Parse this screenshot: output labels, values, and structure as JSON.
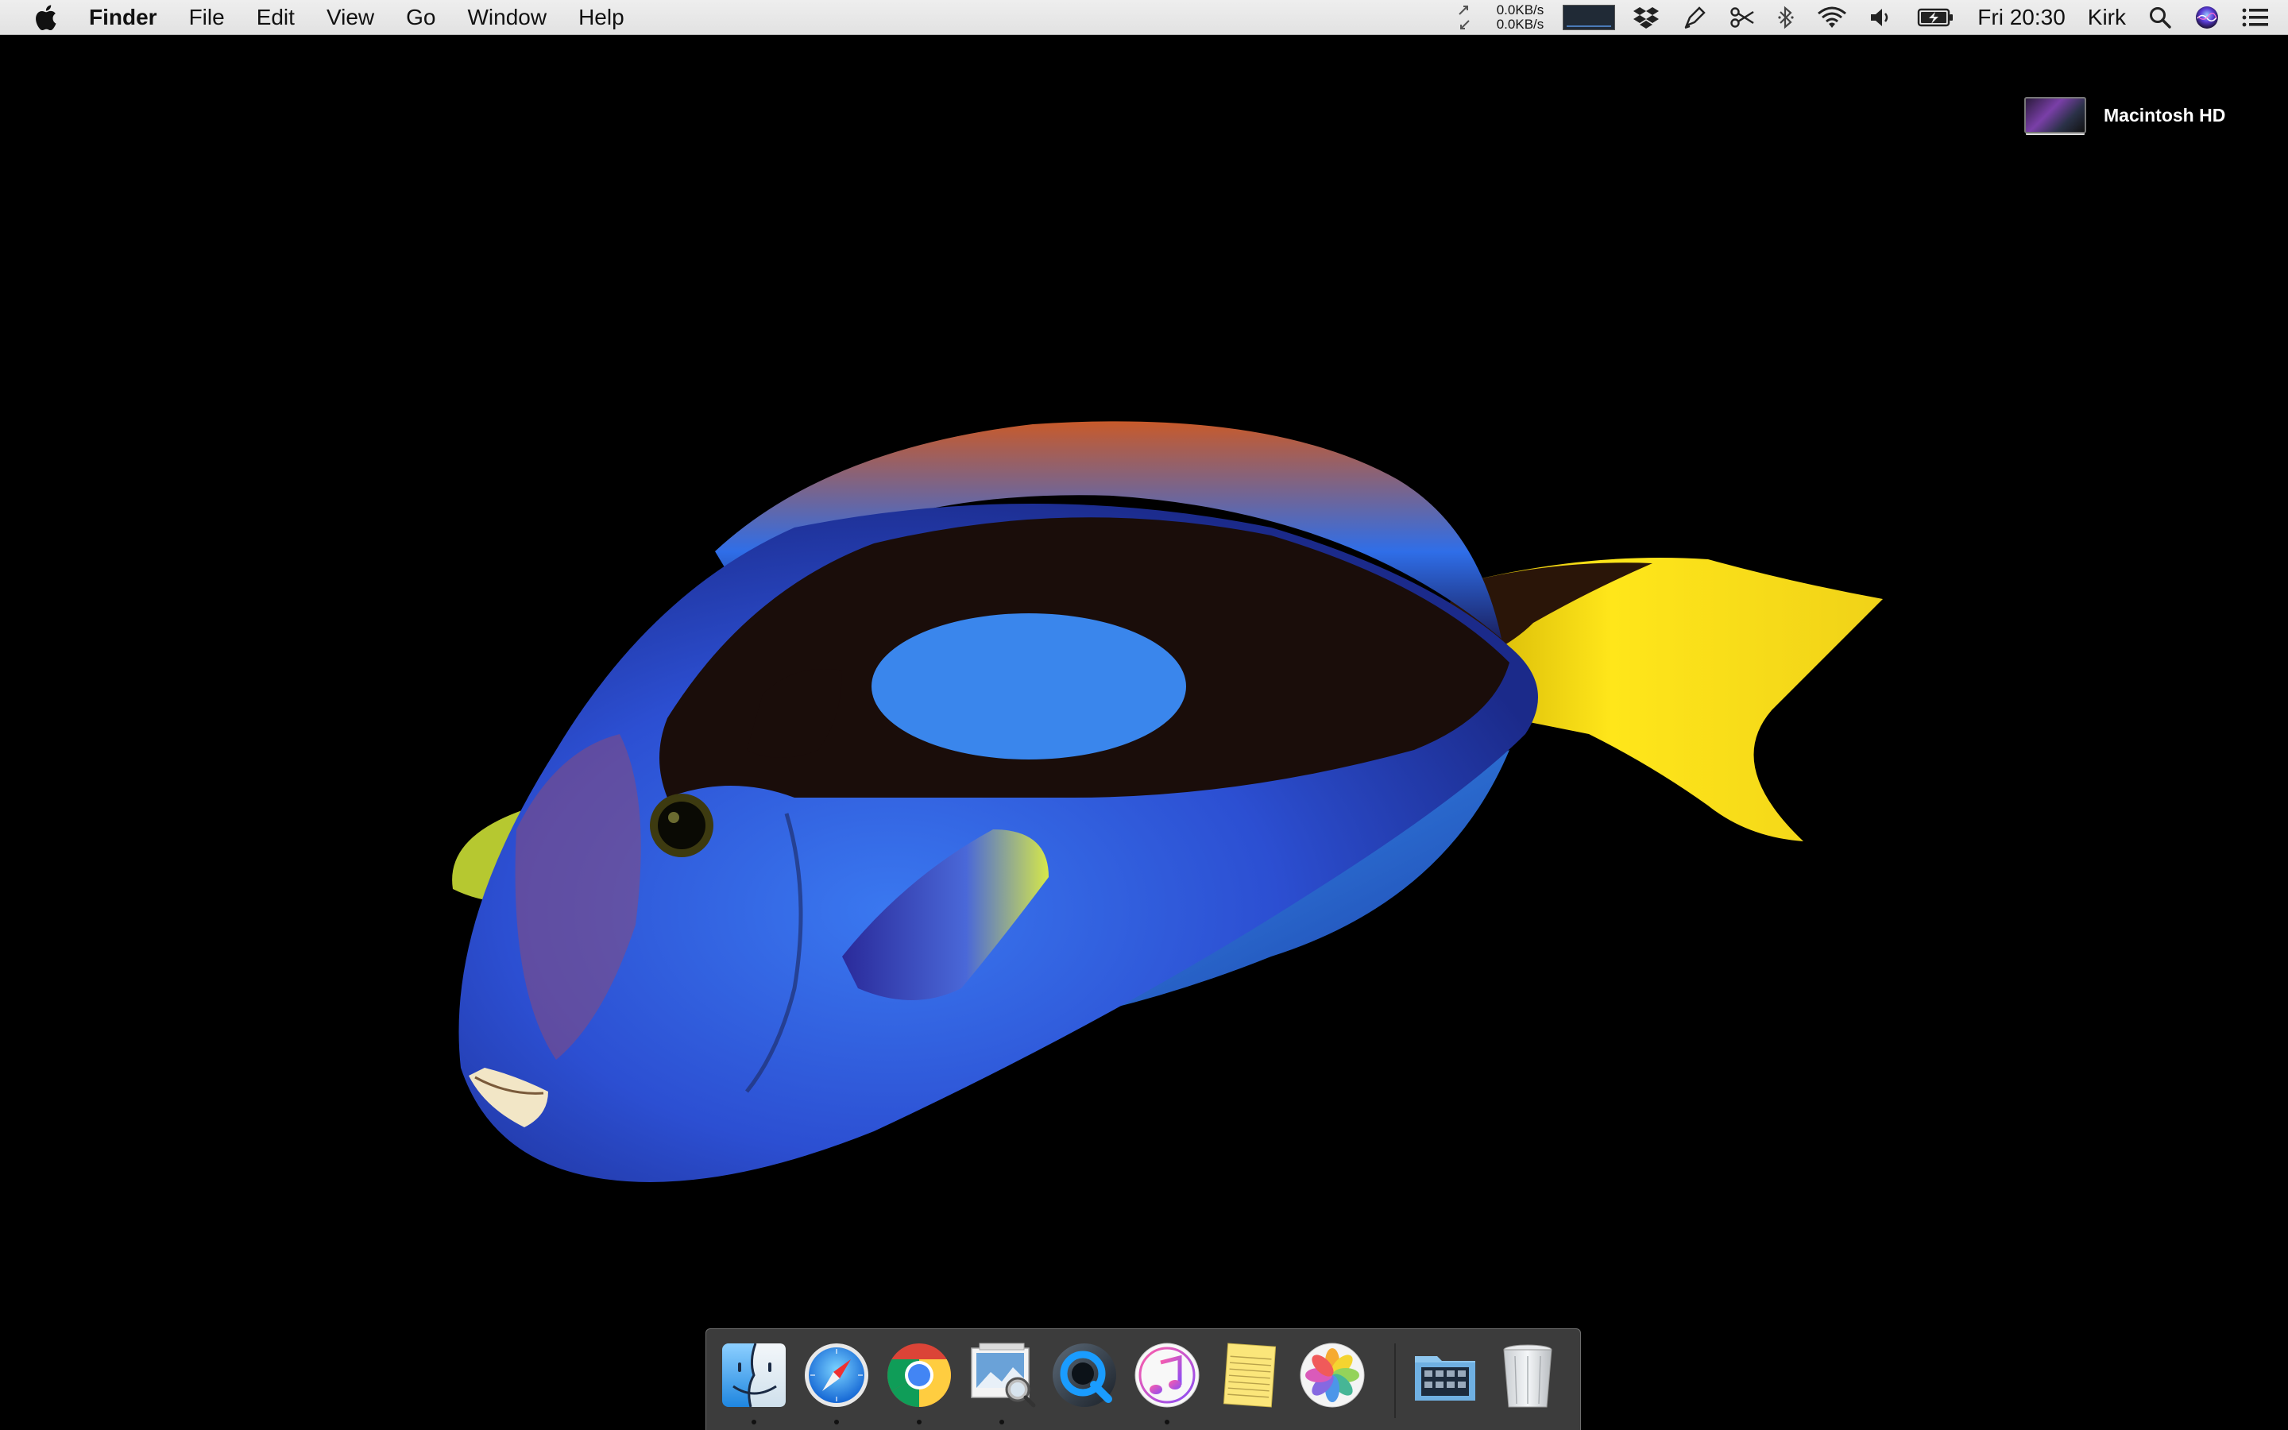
{
  "menubar": {
    "app_name": "Finder",
    "menus": [
      "File",
      "Edit",
      "View",
      "Go",
      "Window",
      "Help"
    ],
    "network": {
      "up": "0.0KB/s",
      "down": "0.0KB/s"
    },
    "clock": "Fri 20:30",
    "user": "Kirk",
    "status_icons": [
      "network-arrows-icon",
      "network-graph-icon",
      "dropbox-icon",
      "pen-icon",
      "scissors-icon",
      "bluetooth-icon",
      "wifi-icon",
      "volume-icon",
      "battery-charging-icon",
      "spotlight-search-icon",
      "siri-icon",
      "notification-center-icon"
    ]
  },
  "desktop": {
    "drive_label": "Macintosh HD",
    "wallpaper": "blue-tang-fish-on-black"
  },
  "dock": {
    "apps": [
      {
        "name": "Finder",
        "icon": "finder-icon",
        "running": true
      },
      {
        "name": "Safari",
        "icon": "safari-icon",
        "running": true
      },
      {
        "name": "Google Chrome",
        "icon": "chrome-icon",
        "running": true
      },
      {
        "name": "Preview",
        "icon": "preview-icon",
        "running": true
      },
      {
        "name": "QuickTime Player",
        "icon": "quicktime-icon",
        "running": false
      },
      {
        "name": "iTunes",
        "icon": "itunes-icon",
        "running": true
      },
      {
        "name": "Notes",
        "icon": "notes-icon",
        "running": false
      },
      {
        "name": "Photos",
        "icon": "photos-icon",
        "running": false
      }
    ],
    "others": [
      {
        "name": "Applications",
        "icon": "applications-folder-icon"
      },
      {
        "name": "Trash",
        "icon": "trash-icon"
      }
    ]
  },
  "colors": {
    "menubar_bg": "#e8e8e8",
    "desktop_bg": "#000000",
    "fish_body": "#2f57d6",
    "fish_tail": "#f5de1a",
    "fish_band": "#1a0d0a"
  }
}
